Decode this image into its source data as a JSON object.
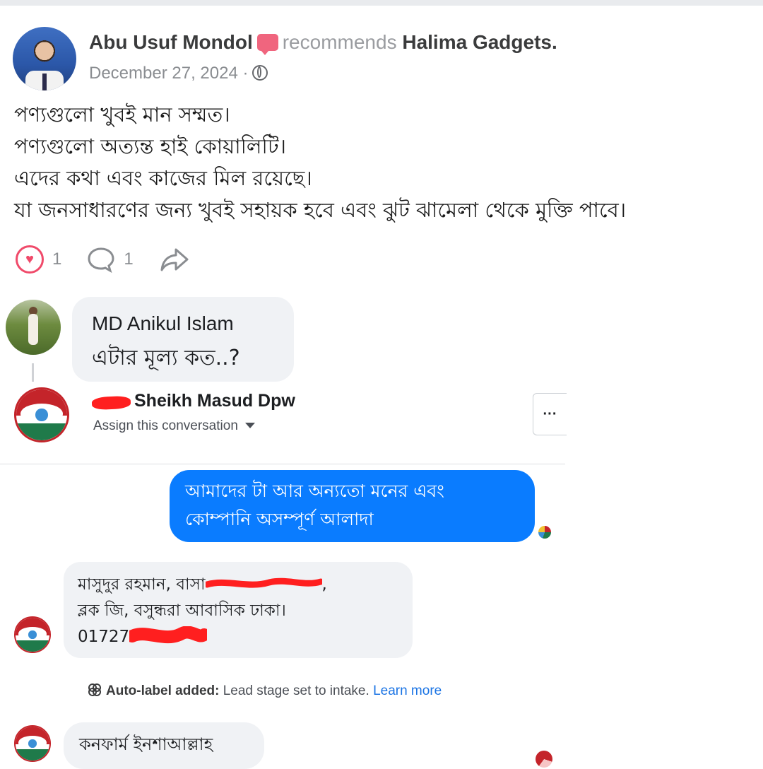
{
  "post": {
    "author": "Abu Usuf Mondol",
    "recommend_verb": "recommends",
    "page_name": "Halima Gadgets.",
    "date": "December 27, 2024 ·",
    "body_lines": [
      "পণ্যগুলো খুবই মান সম্মত।",
      "পণ্যগুলো অত্যন্ত হাই কোয়ালিটি।",
      "এদের কথা এবং কাজের মিল রয়েছে।",
      "যা জনসাধারণের জন্য খুবই সহায়ক হবে এবং ঝুট ঝামেলা থেকে মুক্তি পাবে।"
    ],
    "reaction_count": "1",
    "comment_count": "1"
  },
  "comment": {
    "name": "MD Anikul Islam",
    "text": "এটার মূল্য কত..?"
  },
  "inbox": {
    "contact_name": "Sheikh Masud Dpw",
    "assign_label": "Assign this conversation",
    "more_label": "···",
    "messages": {
      "sent_line1": "আমাদের টা আর অন্যতো মনের এবং",
      "sent_line2": "কোম্পানি অসম্পূর্ণ আলাদা",
      "recv_line1": "মাসুদুর রহমান, বাসা",
      "recv_line1_end": ",",
      "recv_line2": "ব্লক জি, বসুন্ধরা আবাসিক ঢাকা।",
      "recv_line3": "01727",
      "confirm": "কনফার্ম ইনশাআল্লাহ"
    },
    "auto_label": {
      "strong": "Auto-label added:",
      "text": "Lead stage set to intake.",
      "link": "Learn more"
    }
  },
  "colors": {
    "messenger_blue": "#0a7cff",
    "link_blue": "#1b74e4",
    "bubble_grey": "#f0f2f5",
    "heart": "#f04a6a",
    "redaction": "#ff1f1f"
  },
  "icons": [
    "recommend-icon",
    "globe-icon",
    "heart-icon",
    "comment-icon",
    "share-icon",
    "caret-down-icon",
    "auto-label-icon"
  ]
}
